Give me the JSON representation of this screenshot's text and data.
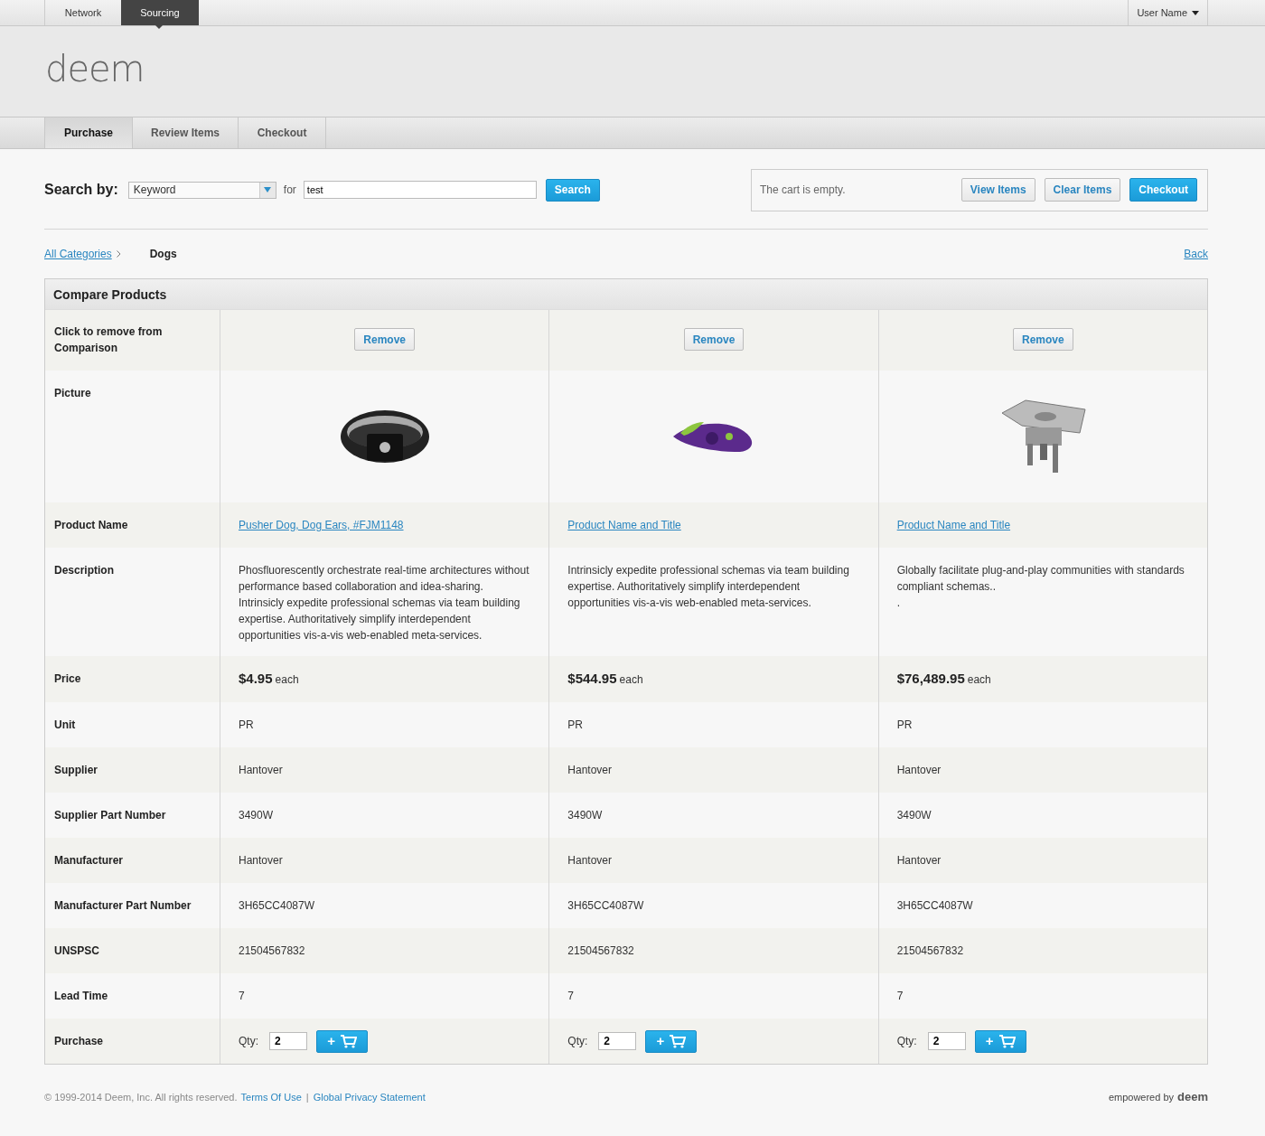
{
  "top_nav": {
    "items": [
      {
        "label": "Network",
        "selected": false
      },
      {
        "label": "Sourcing",
        "selected": true
      }
    ],
    "user_menu": "User Name"
  },
  "logo": "deem",
  "tabs": [
    {
      "label": "Purchase",
      "selected": true
    },
    {
      "label": "Review Items",
      "selected": false
    },
    {
      "label": "Checkout",
      "selected": false
    }
  ],
  "search": {
    "label": "Search by:",
    "type_value": "Keyword",
    "for_label": "for",
    "query": "test",
    "button": "Search"
  },
  "cart": {
    "status": "The cart is empty.",
    "buttons": [
      {
        "label": "View Items",
        "kind": "secondary"
      },
      {
        "label": "Clear Items",
        "kind": "secondary"
      },
      {
        "label": "Checkout",
        "kind": "primary"
      }
    ]
  },
  "breadcrumb": {
    "link": "All Categories",
    "current": "Dogs",
    "back": "Back"
  },
  "compare": {
    "title": "Compare Products",
    "row_labels": {
      "remove": "Click to remove from Comparison",
      "picture": "Picture",
      "name": "Product Name",
      "description": "Description",
      "price": "Price",
      "unit": "Unit",
      "supplier": "Supplier",
      "supplier_part": "Supplier Part Number",
      "manufacturer": "Manufacturer",
      "manufacturer_part": "Manufacturer Part Number",
      "unspsc": "UNSPSC",
      "lead_time": "Lead Time",
      "purchase": "Purchase"
    },
    "products": [
      {
        "remove": "Remove",
        "kind": "wristband",
        "name": "Pusher Dog, Dog Ears, #FJM1148",
        "description": "Phosfluorescently orchestrate real-time architectures without performance based collaboration and idea-sharing. Intrinsicly expedite professional schemas via team building expertise. Authoritatively simplify interdependent opportunities vis-a-vis web-enabled meta-services.",
        "price": "$4.95",
        "price_unit": "each",
        "unit": "PR",
        "supplier": "Hantover",
        "supplier_part": "3490W",
        "manufacturer": "Hantover",
        "manufacturer_part": "3H65CC4087W",
        "unspsc": "21504567832",
        "lead_time": "7",
        "qty_label": "Qty:",
        "qty": "2",
        "add": "+"
      },
      {
        "remove": "Remove",
        "kind": "tape",
        "name": "Product Name and Title",
        "description": "Intrinsicly expedite professional schemas via team building expertise. Authoritatively simplify interdependent opportunities vis-a-vis web-enabled meta-services.",
        "price": "$544.95",
        "price_unit": "each",
        "unit": "PR",
        "supplier": "Hantover",
        "supplier_part": "3490W",
        "manufacturer": "Hantover",
        "manufacturer_part": "3H65CC4087W",
        "unspsc": "21504567832",
        "lead_time": "7",
        "qty_label": "Qty:",
        "qty": "2",
        "add": "+"
      },
      {
        "remove": "Remove",
        "kind": "plate",
        "name": "Product Name and Title",
        "description": "Globally facilitate plug-and-play communities with standards compliant schemas..\n.",
        "price": "$76,489.95",
        "price_unit": "each",
        "unit": "PR",
        "supplier": "Hantover",
        "supplier_part": "3490W",
        "manufacturer": "Hantover",
        "manufacturer_part": "3H65CC4087W",
        "unspsc": "21504567832",
        "lead_time": "7",
        "qty_label": "Qty:",
        "qty": "2",
        "add": "+"
      }
    ]
  },
  "footer": {
    "copyright": "© 1999-2014 Deem, Inc. All rights reserved.",
    "links": [
      "Terms Of Use",
      "Global Privacy Statement"
    ],
    "separator": "|",
    "powered_label": "empowered by",
    "powered_brand": "deem"
  }
}
